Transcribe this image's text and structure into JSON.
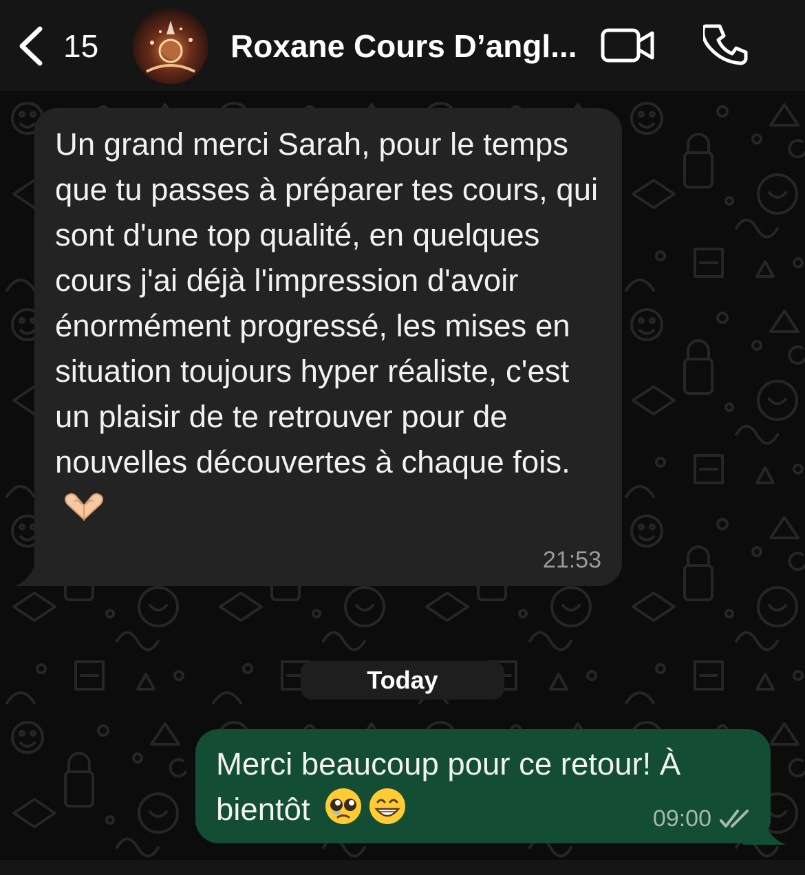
{
  "header": {
    "back_count": "15",
    "chat_name": "Roxane Cours D’angl...",
    "icons": [
      "chevron-left-icon",
      "avatar",
      "video-camera-icon",
      "phone-icon"
    ]
  },
  "messages": [
    {
      "direction": "incoming",
      "text": "Un grand merci Sarah, pour le temps que tu passes à préparer tes cours, qui sont d'une top qualité, en quelques cours j'ai déjà l'impression d'avoir énormément progressé, les mises en situation toujours hyper réaliste, c'est un plaisir de te retrouver pour de nouvelles découvertes à chaque fois.",
      "emoji": "heart-hands",
      "time": "21:53"
    },
    {
      "direction": "outgoing",
      "text": "Merci beaucoup pour ce retour! À bientôt",
      "emoji": [
        "pleading-face",
        "grinning-face"
      ],
      "time": "09:00",
      "status": "read"
    }
  ],
  "date_separator": "Today",
  "colors": {
    "header_bg": "#151515",
    "background": "#0c0c0c",
    "incoming_bubble": "#232323",
    "outgoing_bubble": "#124d34",
    "read_ticks": "#a7b8ae"
  }
}
